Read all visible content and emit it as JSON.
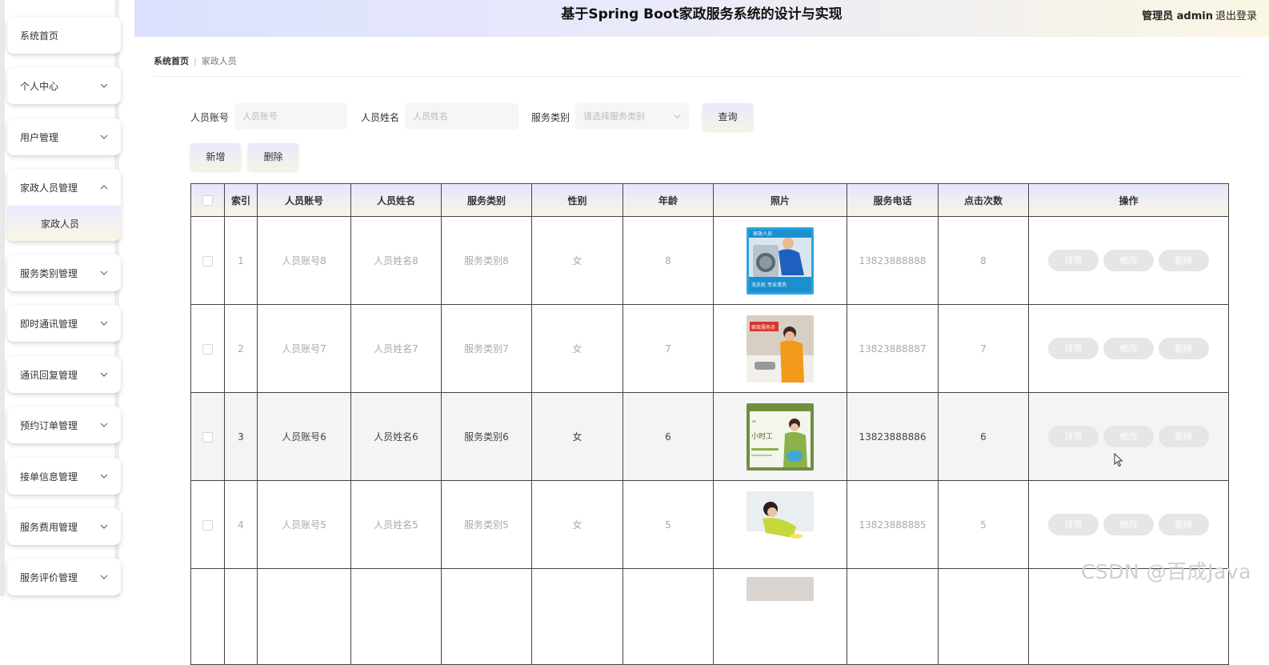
{
  "sidebar": {
    "items": [
      {
        "label": "系统首页",
        "has_chevron": false
      },
      {
        "label": "个人中心",
        "has_chevron": true
      },
      {
        "label": "用户管理",
        "has_chevron": true
      },
      {
        "label": "家政人员管理",
        "has_chevron": true,
        "expanded": true,
        "children": [
          "家政人员"
        ]
      },
      {
        "label": "服务类别管理",
        "has_chevron": true
      },
      {
        "label": "即时通讯管理",
        "has_chevron": true
      },
      {
        "label": "通讯回复管理",
        "has_chevron": true
      },
      {
        "label": "预约订单管理",
        "has_chevron": true
      },
      {
        "label": "接单信息管理",
        "has_chevron": true
      },
      {
        "label": "服务费用管理",
        "has_chevron": true
      },
      {
        "label": "服务评价管理",
        "has_chevron": true
      }
    ]
  },
  "header": {
    "title": "基于Spring Boot家政服务系统的设计与实现",
    "user_label": "管理员 admin",
    "logout_label": "退出登录"
  },
  "breadcrumb": {
    "home": "系统首页",
    "current": "家政人员"
  },
  "filters": {
    "account_label": "人员账号",
    "account_placeholder": "人员账号",
    "name_label": "人员姓名",
    "name_placeholder": "人员姓名",
    "category_label": "服务类别",
    "category_placeholder": "请选择服务类别",
    "search_button": "查询"
  },
  "actions": {
    "add_button": "新增",
    "delete_button": "删除"
  },
  "table": {
    "columns": [
      "",
      "索引",
      "人员账号",
      "人员姓名",
      "服务类别",
      "性别",
      "年龄",
      "照片",
      "服务电话",
      "点击次数",
      "操作"
    ],
    "rows": [
      {
        "index": "1",
        "account": "人员账号8",
        "name": "人员姓名8",
        "category": "服务类别8",
        "gender": "女",
        "age": "8",
        "photo": "washing-machine-cleaner-photo",
        "phone": "13823888888",
        "clicks": "8"
      },
      {
        "index": "2",
        "account": "人员账号7",
        "name": "人员姓名7",
        "category": "服务类别7",
        "gender": "女",
        "age": "7",
        "photo": "housekeeper-cleaning-photo",
        "phone": "13823888887",
        "clicks": "7"
      },
      {
        "index": "3",
        "account": "人员账号6",
        "name": "人员姓名6",
        "category": "服务类别6",
        "gender": "女",
        "age": "6",
        "photo": "hourly-worker-poster-photo",
        "phone": "13823888886",
        "clicks": "6"
      },
      {
        "index": "4",
        "account": "人员账号5",
        "name": "人员姓名5",
        "category": "服务类别5",
        "gender": "女",
        "age": "5",
        "photo": "table-wiping-photo",
        "phone": "13823888885",
        "clicks": "5"
      }
    ],
    "row_buttons": {
      "detail": "详情",
      "edit": "修改",
      "delete": "删除"
    },
    "highlighted_row": 3
  },
  "photo_texts": {
    "p1_top": "家政人员",
    "p1_bottom": "洗衣机 专业清洗",
    "p2_tag": "家政服务员",
    "p3_quote": "“",
    "p3_title": "小时工"
  },
  "watermark": "CSDN @百成Java",
  "colors": {
    "accent_lavender": "#e2e6ff",
    "accent_cream": "#fbf5e4",
    "button_grey": "#e6e6e6"
  }
}
